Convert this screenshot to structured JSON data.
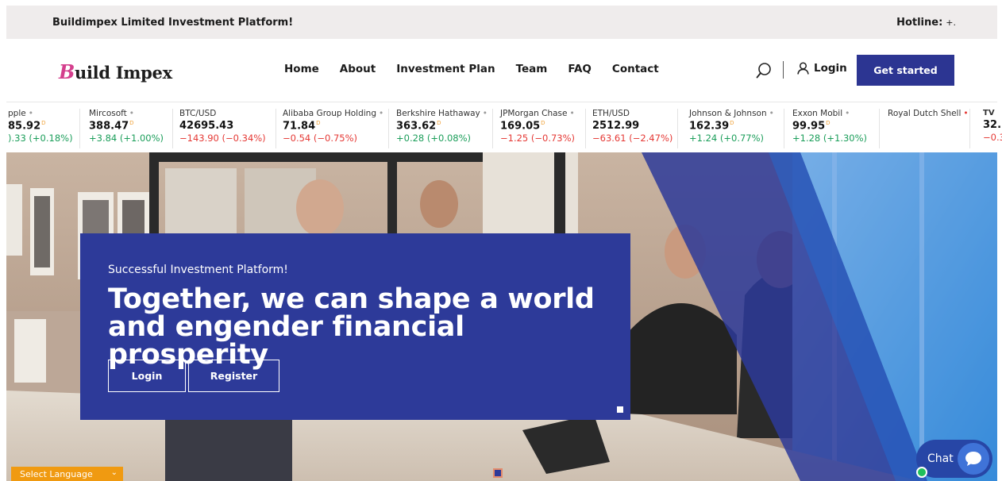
{
  "topbar": {
    "tagline": "Buildimpex Limited Investment Platform!",
    "hotline_label": "Hotline:",
    "hotline_number": "+."
  },
  "brand": {
    "logo_initial": "B",
    "logo_rest": "uild Impex",
    "accent_color": "#d43f8d"
  },
  "nav": {
    "items": [
      "Home",
      "About",
      "Investment Plan",
      "Team",
      "FAQ",
      "Contact"
    ],
    "login_label": "Login",
    "cta_label": "Get started",
    "cta_color": "#2c3592"
  },
  "ticker": [
    {
      "name": "pple",
      "price": "85.92",
      "delayed": "D",
      "change": ").33 (+0.18%)",
      "dir": "up"
    },
    {
      "name": "Mircosoft",
      "price": "388.47",
      "delayed": "D",
      "change": "+3.84 (+1.00%)",
      "dir": "up"
    },
    {
      "name": "BTC/USD",
      "price": "42695.43",
      "delayed": "",
      "change": "−143.90 (−0.34%)",
      "dir": "down"
    },
    {
      "name": "Alibaba Group Holding",
      "price": "71.84",
      "delayed": "D",
      "change": "−0.54 (−0.75%)",
      "dir": "down"
    },
    {
      "name": "Berkshire Hathaway",
      "price": "363.62",
      "delayed": "D",
      "change": "+0.28 (+0.08%)",
      "dir": "up"
    },
    {
      "name": "JPMorgan Chase",
      "price": "169.05",
      "delayed": "D",
      "change": "−1.25 (−0.73%)",
      "dir": "down"
    },
    {
      "name": "ETH/USD",
      "price": "2512.99",
      "delayed": "",
      "change": "−63.61 (−2.47%)",
      "dir": "down"
    },
    {
      "name": "Johnson & Johnson",
      "price": "162.39",
      "delayed": "D",
      "change": "+1.24 (+0.77%)",
      "dir": "up"
    },
    {
      "name": "Exxon Mobil",
      "price": "99.95",
      "delayed": "D",
      "change": "+1.28 (+1.30%)",
      "dir": "up"
    },
    {
      "name": "Royal Dutch Shell",
      "price": "",
      "delayed": "",
      "change": "",
      "dir": "up"
    },
    {
      "name": "TV",
      "price": "32.",
      "delayed": "",
      "change": "−0.3",
      "dir": "down"
    }
  ],
  "hero": {
    "subtitle": "Successful Investment Platform!",
    "title": "Together, we can shape a world and engender financial prosperity",
    "login_label": "Login",
    "register_label": "Register",
    "box_color": "#2d3a99"
  },
  "language": {
    "selected": "Select Language"
  },
  "chat": {
    "label": "Chat"
  }
}
